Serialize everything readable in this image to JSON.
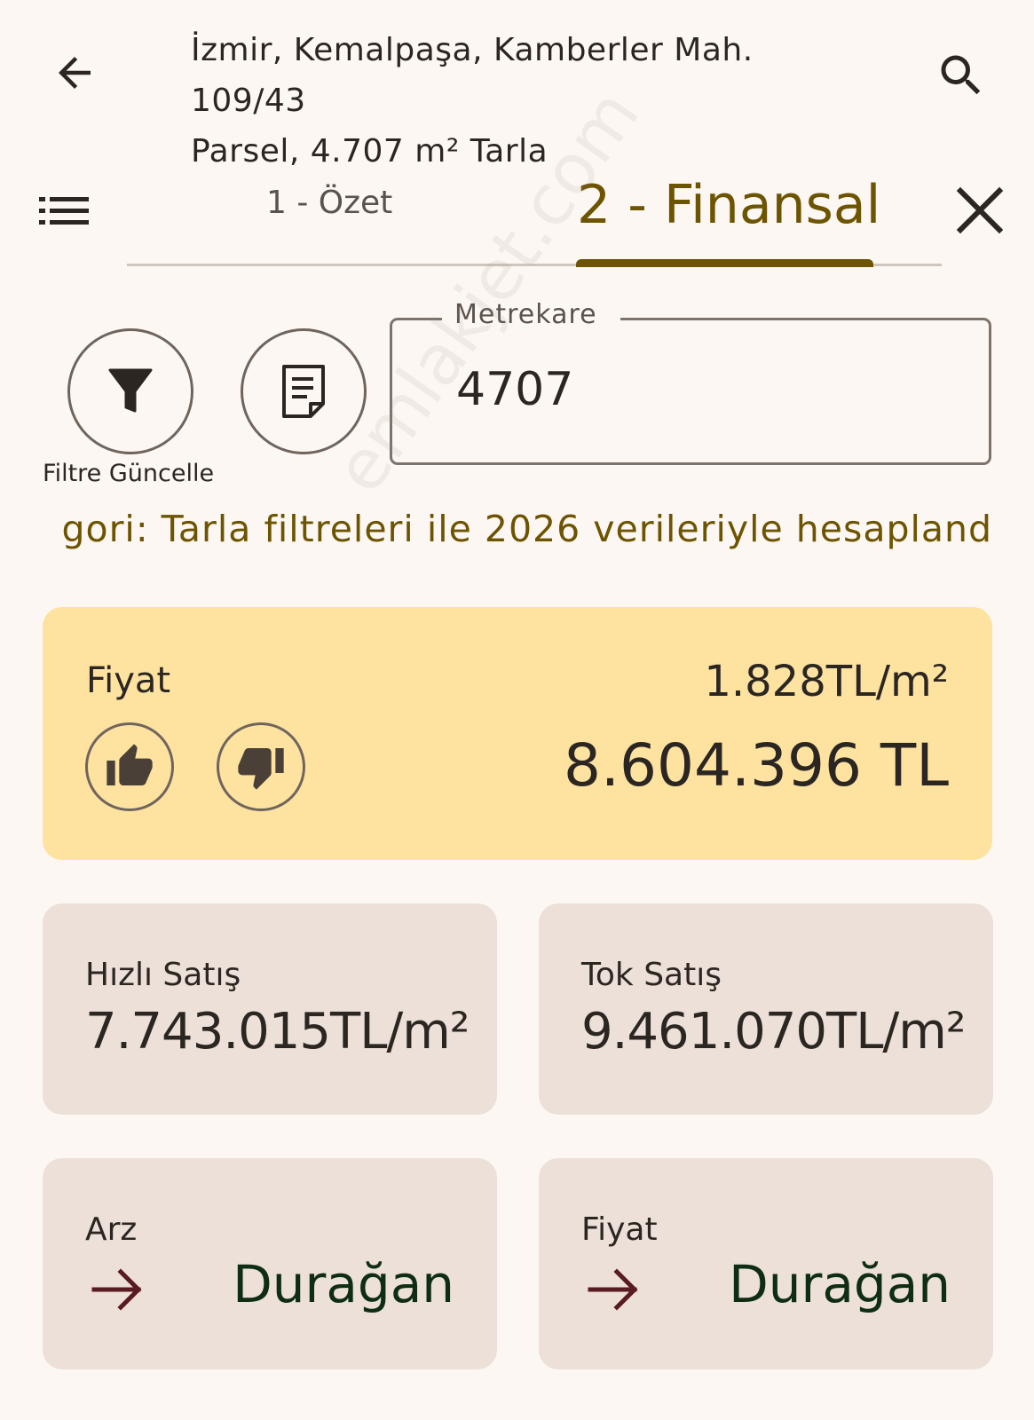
{
  "header": {
    "back_icon": "arrow-left-icon",
    "title_line1": "İzmir, Kemalpaşa, Kamberler Mah. 109/43",
    "title_line2": "Parsel, 4.707 m² Tarla",
    "search_icon": "search-icon"
  },
  "tabs": {
    "menu_icon": "list-icon",
    "items": [
      {
        "label": "1 - Özet",
        "selected": false
      },
      {
        "label": "2 - Finansal",
        "selected": true
      }
    ],
    "close_icon": "close-icon",
    "accent_color": "#6d5400"
  },
  "actions": {
    "filter_icon": "filter-icon",
    "filter_label": "Filtre Güncelle",
    "report_icon": "document-icon"
  },
  "area_field": {
    "label": "Metrekare",
    "value": "4707"
  },
  "info_text": "gori: Tarla filtreleri ile 2026 verileriyle hesapland",
  "price_card": {
    "label": "Fiyat",
    "per_m2": "1.828TL/m²",
    "total": "8.604.396 TL",
    "like_icon": "thumbs-up-icon",
    "dislike_icon": "thumbs-down-icon",
    "background": "#fde2a0"
  },
  "stats": [
    {
      "title": "Hızlı Satış",
      "value": "7.743.015TL/m²"
    },
    {
      "title": "Tok Satış",
      "value": "9.461.070TL/m²"
    }
  ],
  "trends": [
    {
      "title": "Arz",
      "value": "Durağan",
      "icon": "arrow-right-icon"
    },
    {
      "title": "Fiyat",
      "value": "Durağan",
      "icon": "arrow-right-icon"
    }
  ],
  "watermark": "emlakjet.com"
}
